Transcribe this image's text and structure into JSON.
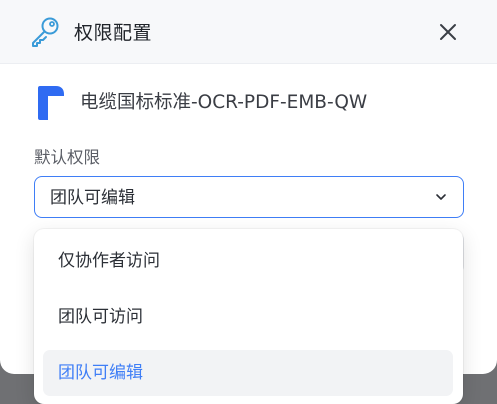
{
  "dialog": {
    "title": "权限配置",
    "close_icon": "close-icon",
    "header_icon": "key-icon"
  },
  "file": {
    "icon": "document-logo-icon",
    "name": "电缆国标标准-OCR-PDF-EMB-QW"
  },
  "permission": {
    "label": "默认权限",
    "selected_value": "团队可编辑",
    "options": [
      {
        "label": "仅协作者访问",
        "selected": false
      },
      {
        "label": "团队可访问",
        "selected": false
      },
      {
        "label": "团队可编辑",
        "selected": true
      }
    ]
  },
  "colors": {
    "accent": "#3f7ef6",
    "icon_blue": "#2f6bf2",
    "text_primary": "#1f2329",
    "overlay": "#6f7073"
  }
}
